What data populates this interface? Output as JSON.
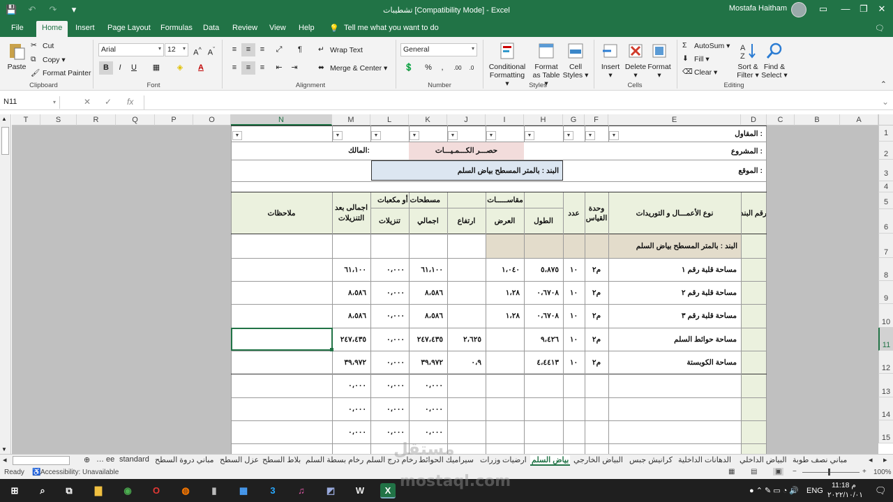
{
  "titlebar": {
    "title": "تشطيبات  [Compatibility Mode]  -  Excel",
    "user": "Mostafa Haitham"
  },
  "tabs": [
    "File",
    "Home",
    "Insert",
    "Page Layout",
    "Formulas",
    "Data",
    "Review",
    "View",
    "Help"
  ],
  "tell_me": "Tell me what you want to do",
  "ribbon": {
    "clipboard": {
      "paste": "Paste",
      "cut": "Cut",
      "copy": "Copy",
      "format_painter": "Format Painter",
      "label": "Clipboard"
    },
    "font": {
      "name": "Arial",
      "size": "12",
      "bold": "B",
      "italic": "I",
      "underline": "U",
      "label": "Font"
    },
    "alignment": {
      "wrap": "Wrap Text",
      "merge": "Merge & Center",
      "label": "Alignment"
    },
    "number": {
      "format": "General",
      "label": "Number"
    },
    "styles": {
      "conditional": "Conditional Formatting",
      "format_table": "Format as Table",
      "cell_styles": "Cell Styles",
      "label": "Styles"
    },
    "cells": {
      "insert": "Insert",
      "delete": "Delete",
      "format": "Format",
      "label": "Cells"
    },
    "editing": {
      "autosum": "AutoSum",
      "fill": "Fill",
      "clear": "Clear",
      "sort": "Sort & Filter",
      "find": "Find & Select",
      "label": "Editing"
    }
  },
  "formula_bar": {
    "name_box": "N11",
    "value": ""
  },
  "columns": [
    "T",
    "S",
    "R",
    "Q",
    "P",
    "O",
    "N",
    "M",
    "L",
    "K",
    "J",
    "I",
    "H",
    "G",
    "F",
    "E",
    "D",
    "C",
    "B",
    "A"
  ],
  "rows": [
    "1",
    "2",
    "3",
    "4",
    "5",
    "6",
    "7",
    "8",
    "9",
    "10",
    "11",
    "12",
    "13",
    "14",
    "15"
  ],
  "sheet": {
    "contractor": "المقاول :",
    "project": "المشروع :",
    "location": "الموقع :",
    "owner": "المالك:",
    "quantities_title": "حصـــر الكـــمـيـــات",
    "item_title": "البند :  بالمتر المسطح بياض السلم",
    "h_item_no": "رقم البند",
    "h_work_type": "نوع الأعمـــال و التوريدات",
    "h_unit": "وحدة القياس",
    "h_count": "عدد",
    "h_dimensions": "مقاســـــات",
    "h_length": "الطول",
    "h_width": "العرض",
    "h_height": "ارتفاع",
    "h_areas": "مسطحات أو مكعبات",
    "h_total": "اجمالي",
    "h_deductions": "تنزيلات",
    "h_net": "اجمالى بعد التنزيلات",
    "h_notes": "ملاحظات",
    "section_label": "البند :  بالمتر المسطح بياض السلم",
    "data_rows": [
      {
        "name": "مساحة قلبة رقم ١",
        "unit": "م٢",
        "count": "١٠",
        "length": "٥،٨٧٥",
        "width": "١،٠٤٠",
        "height": "",
        "total": "٦١،١٠٠",
        "ded": "٠،٠٠٠",
        "net": "٦١،١٠٠"
      },
      {
        "name": "مساحة قلبة رقم ٢",
        "unit": "م٢",
        "count": "١٠",
        "length": "٠،٦٧٠٨",
        "width": "١،٢٨",
        "height": "",
        "total": "٨،٥٨٦",
        "ded": "٠،٠٠٠",
        "net": "٨،٥٨٦"
      },
      {
        "name": "مساحة قلبة رقم ٣",
        "unit": "م٢",
        "count": "١٠",
        "length": "٠،٦٧٠٨",
        "width": "١،٢٨",
        "height": "",
        "total": "٨،٥٨٦",
        "ded": "٠،٠٠٠",
        "net": "٨،٥٨٦"
      },
      {
        "name": "مساحة حوائط السلم",
        "unit": "م٢",
        "count": "١٠",
        "length": "٩،٤٢٦",
        "width": "",
        "height": "٢،٦٢٥",
        "total": "٢٤٧،٤٣٥",
        "ded": "٠،٠٠٠",
        "net": "٢٤٧،٤٣٥"
      },
      {
        "name": "مساحة الكوبستة",
        "unit": "م٢",
        "count": "١٠",
        "length": "٤،٤٤١٣",
        "width": "",
        "height": "٠،٩",
        "total": "٣٩،٩٧٢",
        "ded": "٠،٠٠٠",
        "net": "٣٩،٩٧٢"
      },
      {
        "name": "",
        "unit": "",
        "count": "",
        "length": "",
        "width": "",
        "height": "",
        "total": "٠،٠٠٠",
        "ded": "٠،٠٠٠",
        "net": "٠،٠٠٠"
      },
      {
        "name": "",
        "unit": "",
        "count": "",
        "length": "",
        "width": "",
        "height": "",
        "total": "٠،٠٠٠",
        "ded": "٠،٠٠٠",
        "net": "٠،٠٠٠"
      },
      {
        "name": "",
        "unit": "",
        "count": "",
        "length": "",
        "width": "",
        "height": "",
        "total": "٠،٠٠٠",
        "ded": "٠،٠٠٠",
        "net": "٠،٠٠٠"
      }
    ]
  },
  "sheet_tabs": [
    "ee",
    "standard",
    "مباني دروة السطح",
    "عزل السطح",
    "بلاط السطح",
    "رخام بسطة السلم",
    "رخام درج السلم",
    "سيراميك الحوائط",
    "وزرات",
    "ارضيات",
    "بياض السلم",
    "البياض الخارجي",
    "كرانيش جبس",
    "الدهانات الداخلية",
    "البياض الداخلي",
    "مباني نصف طوبة"
  ],
  "active_sheet": "بياض السلم",
  "status": {
    "ready": "Ready",
    "accessibility": "Accessibility: Unavailable",
    "zoom": "100%"
  },
  "taskbar": {
    "lang": "ENG",
    "time": "11:18 م",
    "date": "٢٠٢٢/١٠/٠١"
  },
  "watermark": {
    "top": "مستقل",
    "bottom": "mostaql.com"
  }
}
